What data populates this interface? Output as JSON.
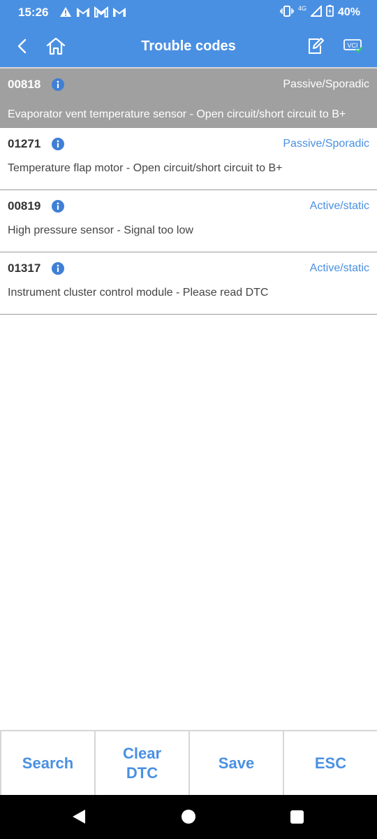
{
  "status_bar": {
    "time": "15:26",
    "notification_icons": [
      "warning-icon",
      "gmail-icon",
      "gmail-icon",
      "gmail-icon"
    ],
    "network": "4G",
    "battery": "40%"
  },
  "header": {
    "title": "Trouble codes",
    "back_icon": "chevron-left-icon",
    "home_icon": "home-icon",
    "edit_icon": "edit-note-icon",
    "vci_icon": "vci-icon",
    "vci_label": "VCI",
    "color": "#4a90e2"
  },
  "dtc_list": [
    {
      "code": "00818",
      "status": "Passive/Sporadic",
      "description": "Evaporator vent temperature sensor - Open circuit/short circuit to B+",
      "selected": true
    },
    {
      "code": "01271",
      "status": "Passive/Sporadic",
      "description": "Temperature flap motor - Open circuit/short circuit to B+",
      "selected": false
    },
    {
      "code": "00819",
      "status": "Active/static",
      "description": "High pressure sensor - Signal too low",
      "selected": false
    },
    {
      "code": "01317",
      "status": "Active/static",
      "description": "Instrument cluster control module - Please read DTC",
      "selected": false
    }
  ],
  "buttons": {
    "search": "Search",
    "clear_line1": "Clear",
    "clear_line2": "DTC",
    "save": "Save",
    "esc": "ESC"
  },
  "colors": {
    "accent": "#4a90e2",
    "selected_row": "#a0a0a0",
    "info_icon": "#3f7fd6"
  }
}
